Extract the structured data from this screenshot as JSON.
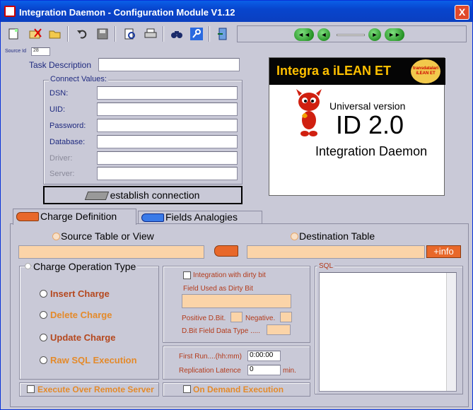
{
  "window": {
    "title": "Integration Daemon - Configuration Module  V1.12",
    "close": "X"
  },
  "toolbar": {
    "icons": [
      "new-icon",
      "delete-icon",
      "open-icon",
      "undo-icon",
      "save-icon",
      "preview-icon",
      "print-icon",
      "find-icon",
      "key-icon",
      "exit-icon"
    ]
  },
  "nav": {
    "first": "◄◄",
    "prev": "◄",
    "next": "►",
    "last": "►►"
  },
  "source_id": {
    "label": "Source Id",
    "value": "28"
  },
  "task": {
    "label": "Task Description",
    "value": ""
  },
  "connect": {
    "title": "Connect Values:",
    "dsn": "DSN:",
    "uid": "UID:",
    "password": "Password:",
    "database": "Database:",
    "driver": "Driver:",
    "server": "Server:"
  },
  "establish_label": "establish connection",
  "logo": {
    "top": "Integra a iLEAN ET",
    "badge": "transdatalari iLEAN ET",
    "line1": "Universal version",
    "line2": "ID 2.0",
    "line3": "Integration Daemon"
  },
  "tabs": {
    "charge": "Charge Definition",
    "fields": "Fields Analogies"
  },
  "source_table": "Source Table or View",
  "destination_table": "Destination Table",
  "info_button": "+info",
  "charge_op": {
    "title": "Charge Operation Type",
    "insert": "Insert Charge",
    "delete": "Delete Charge",
    "update": "Update Charge",
    "raw": "Raw SQL Execution"
  },
  "dirty": {
    "check_label": "Integration with dirty bit",
    "field_label": "Field Used as Dirty Bit",
    "positive": "Positive D.Bit.",
    "negative": "Negative.",
    "type": "D.Bit Field Data Type ....."
  },
  "run": {
    "first_label": "First Run....(hh:mm)",
    "first_value": "0:00:00",
    "latence_label": "Replication Latence",
    "latence_value": "0",
    "unit": "min."
  },
  "sql_label": "SQL",
  "remote": "Execute Over Remote Server",
  "on_demand": "On Demand Execution"
}
